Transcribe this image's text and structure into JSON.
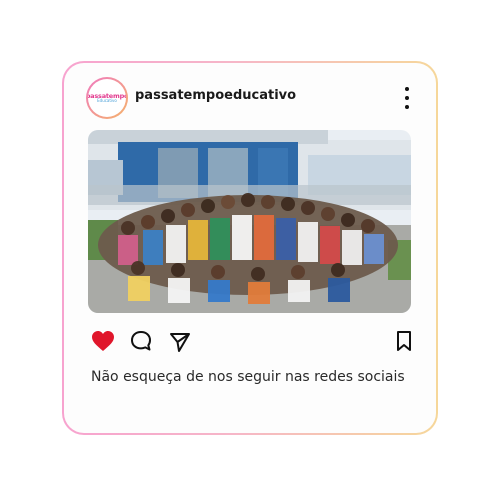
{
  "post": {
    "username": "passatempoeducativo",
    "avatar": {
      "logo_text_top": "passatempo",
      "logo_text_bottom": "Educativo"
    },
    "photo": {
      "icon": "group-photo"
    },
    "actions": {
      "like": {
        "icon": "heart-icon",
        "state": "liked",
        "color": "#e0162b"
      },
      "comment": {
        "icon": "comment-icon"
      },
      "share": {
        "icon": "send-icon"
      },
      "save": {
        "icon": "bookmark-icon"
      }
    },
    "caption": "Não esqueça de nos seguir nas redes sociais"
  },
  "theme": {
    "border_gradient": [
      "#f7a3cf",
      "#f6d79a"
    ],
    "text_color": "#2a2a2a"
  }
}
